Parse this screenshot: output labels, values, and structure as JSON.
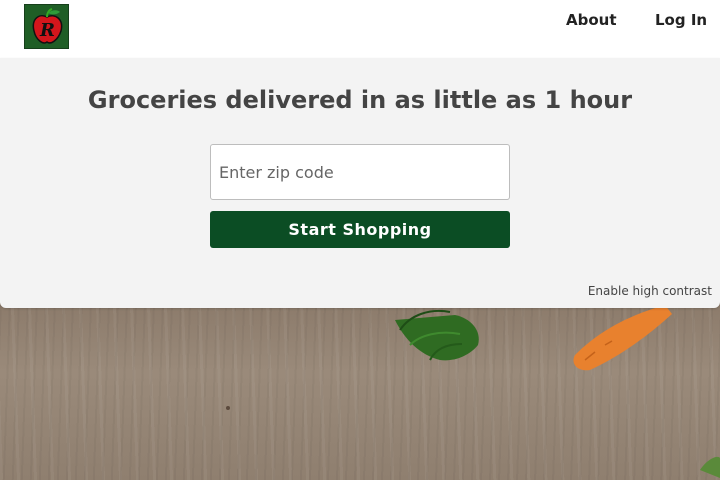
{
  "header": {
    "logo_alt": "store logo",
    "nav": {
      "about": "About",
      "login": "Log In"
    }
  },
  "hero": {
    "headline": "Groceries delivered in as little as 1 hour",
    "zip_placeholder": "Enter zip code",
    "zip_value": "",
    "start_button": "Start Shopping",
    "contrast_link": "Enable high contrast"
  },
  "colors": {
    "primary_button": "#0b4d24",
    "hero_background": "#f3f3f3",
    "headline_text": "#444444"
  },
  "background": {
    "icons": [
      "wood-background",
      "parsley-icon",
      "carrot-icon"
    ]
  }
}
